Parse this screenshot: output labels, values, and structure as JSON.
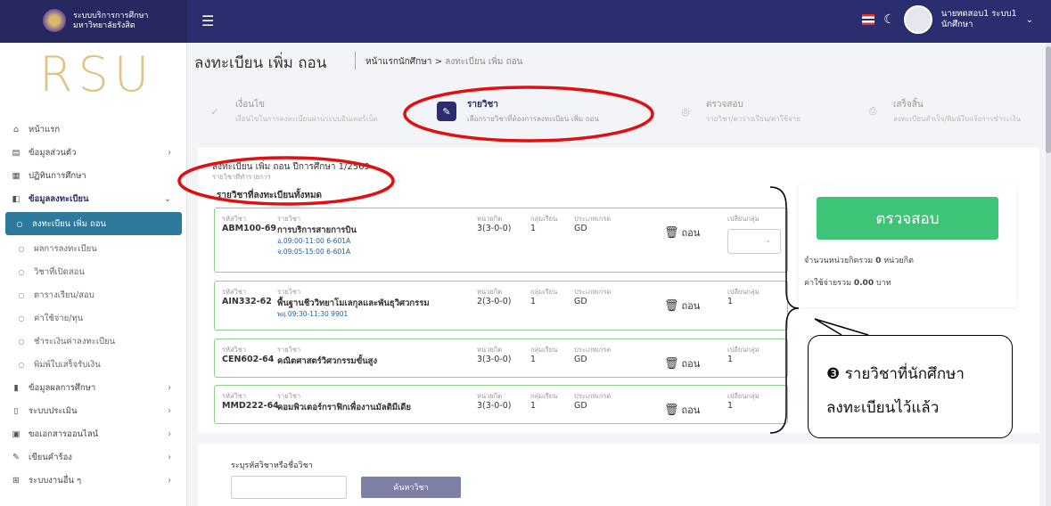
{
  "header": {
    "brand_line1": "ระบบบริการการศึกษา",
    "brand_line2": "มหาวิทยาลัยรังสิต",
    "user_name": "นายทดสอบ1 ระบบ1",
    "user_role": "นักศึกษา"
  },
  "sidebar": {
    "logo_text": "RSU",
    "items": [
      {
        "label": "หน้าแรก",
        "icon": "home-icon"
      },
      {
        "label": "ข้อมูลส่วนตัว",
        "icon": "id-card-icon"
      },
      {
        "label": "ปฏิทินการศึกษา",
        "icon": "calendar-icon"
      },
      {
        "label": "ข้อมูลลงทะเบียน",
        "icon": "register-icon"
      },
      {
        "label": "ลงทะเบียน เพิ่ม ถอน",
        "icon": "circle-icon"
      },
      {
        "label": "ผลการลงทะเบียน",
        "icon": "circle-icon"
      },
      {
        "label": "วิชาที่เปิดสอน",
        "icon": "circle-icon"
      },
      {
        "label": "ตารางเรียน/สอบ",
        "icon": "circle-icon"
      },
      {
        "label": "ค่าใช้จ่าย/ทุน",
        "icon": "circle-icon"
      },
      {
        "label": "ชำระเงินค่าลงทะเบียน",
        "icon": "circle-icon"
      },
      {
        "label": "พิมพ์ใบเสร็จรับเงิน",
        "icon": "circle-icon"
      },
      {
        "label": "ข้อมูลผลการศึกษา",
        "icon": "book-icon"
      },
      {
        "label": "ระบบประเมิน",
        "icon": "clipboard-icon"
      },
      {
        "label": "ขอเอกสารออนไลน์",
        "icon": "document-icon"
      },
      {
        "label": "เขียนคำร้อง",
        "icon": "pen-icon"
      },
      {
        "label": "ระบบงานอื่น ๆ",
        "icon": "grid-icon"
      }
    ]
  },
  "page": {
    "title": "ลงทะเบียน เพิ่ม ถอน",
    "breadcrumb_home": "หน้าแรกนักศึกษา",
    "breadcrumb_sep": ">",
    "breadcrumb_current": "ลงทะเบียน เพิ่ม ถอน"
  },
  "steps": [
    {
      "title": "เงื่อนไข",
      "desc": "เงื่อนไขในการลงทะเบียนผ่านระบบอินเตอร์เน็ต"
    },
    {
      "title": "รายวิชา",
      "desc": "เลือกรายวิชาที่ต้องการลงทะเบียน เพิ่ม ถอน"
    },
    {
      "title": "ตรวจสอบ",
      "desc": "รายวิชา/ตารางเรียน/ค่าใช้จ่าย"
    },
    {
      "title": "เสร็จสิ้น",
      "desc": "ลงทะเบียนสำเร็จ/พิมพ์ใบแจ้งการชำระเงิน"
    }
  ],
  "registration": {
    "semester_title": "ลงทะเบียน เพิ่ม ถอน ปีการศึกษา 1/2569",
    "semester_sub": "รายวิชาที่ทำรายการ",
    "list_title": "รายวิชาที่ลงทะเบียนทั้งหมด",
    "labels": {
      "code": "รหัสวิชา",
      "name": "รายวิชา",
      "credit": "หน่วยกิต",
      "group": "กลุ่มเรียน",
      "grade_type": "ประเภทเกรด",
      "change_group": "เปลี่ยนกลุ่ม",
      "drop": "ถอน"
    },
    "courses": [
      {
        "code": "ABM100-69",
        "name": "การบริการสายการบิน",
        "credit": "3(3-0-0)",
        "group": "1",
        "grade_type": "GD",
        "times": [
          "อ.09:00-11:00 6-601A",
          "จ.09:05-15:00 6-601A"
        ],
        "change_group": ""
      },
      {
        "code": "AIN332-62",
        "name": "พื้นฐานชีววิทยาโมเลกุลและพันธุวิศวกรรม",
        "credit": "2(3-0-0)",
        "group": "1",
        "grade_type": "GD",
        "times": [
          "พฤ.09:30-11:30 9901"
        ],
        "change_group": "1"
      },
      {
        "code": "CEN602-64",
        "name": "คณิตศาสตร์วิศวกรรมขั้นสูง",
        "credit": "3(3-0-0)",
        "group": "1",
        "grade_type": "GD",
        "times": [],
        "change_group": "1"
      },
      {
        "code": "MMD222-64",
        "name": "คอมพิวเตอร์กราฟิกเพื่องานมัลติมีเดีย",
        "credit": "3(3-0-0)",
        "group": "1",
        "grade_type": "GD",
        "times": [],
        "change_group": "1"
      }
    ]
  },
  "summary": {
    "check_button": "ตรวจสอบ",
    "credit_prefix": "จำนวนหน่วยกิตรวม",
    "credit_value": "0",
    "credit_suffix": "หน่วยกิต",
    "cost_prefix": "ค่าใช้จ่ายรวม",
    "cost_value": "0.00",
    "cost_suffix": "บาท"
  },
  "callout": {
    "line1": "❸ รายวิชาที่นักศึกษา",
    "line2": "ลงทะเบียนไว้แล้ว"
  },
  "search": {
    "label": "ระบุรหัสวิชาหรือชื่อวิชา",
    "placeholder": "",
    "button": "ค้นหาวิชา"
  },
  "colors": {
    "topbar": "#2b2d6e",
    "active_nav": "#2d7a9c",
    "check_button": "#3ec476",
    "course_border": "#8fd18a",
    "annotation": "#e01010"
  }
}
